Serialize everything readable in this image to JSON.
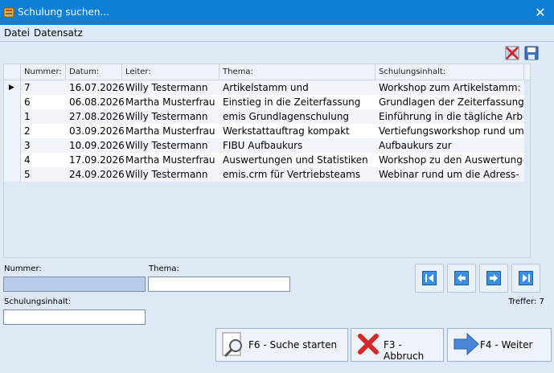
{
  "window": {
    "title": "Schulung suchen..."
  },
  "menu": {
    "items": [
      {
        "label": "Datei"
      },
      {
        "label": "Datensatz"
      }
    ]
  },
  "grid": {
    "columns": [
      "Nummer:",
      "Datum:",
      "Leiter:",
      "Thema:",
      "Schulungsinhalt:"
    ],
    "rows": [
      {
        "nummer": "7",
        "datum": "16.07.2026",
        "leiter": "Willy Testermann",
        "thema": "Artikelstamm und",
        "inhalt": "Workshop zum Artikelstamm:"
      },
      {
        "nummer": "6",
        "datum": "06.08.2026",
        "leiter": "Martha Musterfrau",
        "thema": "Einstieg in die Zeiterfassung",
        "inhalt": "Grundlagen der Zeiterfassung:"
      },
      {
        "nummer": "1",
        "datum": "27.08.2026",
        "leiter": "Willy Testermann",
        "thema": "emis Grundlagenschulung",
        "inhalt": "Einführung in die tägliche Arbeit"
      },
      {
        "nummer": "2",
        "datum": "03.09.2026",
        "leiter": "Martha Musterfrau",
        "thema": "Werkstattauftrag kompakt",
        "inhalt": "Vertiefungsworkshop rund um"
      },
      {
        "nummer": "3",
        "datum": "10.09.2026",
        "leiter": "Willy Testermann",
        "thema": "FIBU Aufbaukurs",
        "inhalt": "Aufbaukurs zur"
      },
      {
        "nummer": "4",
        "datum": "17.09.2026",
        "leiter": "Martha Musterfrau",
        "thema": "Auswertungen und Statistiken",
        "inhalt": "Workshop zu den Auswertungen"
      },
      {
        "nummer": "5",
        "datum": "24.09.2026",
        "leiter": "Willy Testermann",
        "thema": "emis.crm für Vertriebsteams",
        "inhalt": "Webinar rund um die Adress-"
      }
    ]
  },
  "form": {
    "nummer_label": "Nummer:",
    "nummer_value": "",
    "thema_label": "Thema:",
    "thema_value": "",
    "inhalt_label": "Schulungsinhalt:",
    "inhalt_value": ""
  },
  "status": {
    "hits": "Treffer: 7"
  },
  "buttons": {
    "search": "F6 - Suche starten",
    "cancel": "F3 - Abbruch",
    "next": "F4 - Weiter"
  },
  "colors": {
    "titlebar": "#0f7fd6",
    "background": "#dfe9f5",
    "focus": "#b7cde9"
  }
}
